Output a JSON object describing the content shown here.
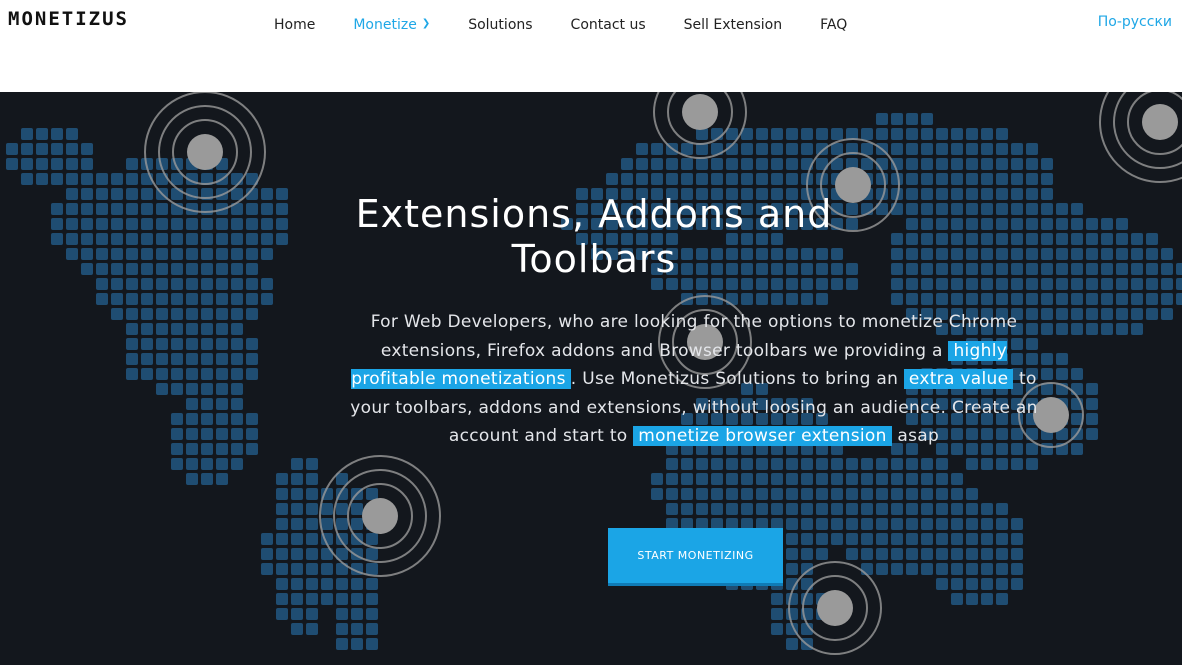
{
  "header": {
    "logo": "MONETIZUS",
    "nav": [
      {
        "label": "Home"
      },
      {
        "label": "Monetize",
        "active": true
      },
      {
        "label": "Solutions"
      },
      {
        "label": "Contact us"
      },
      {
        "label": "Sell Extension"
      },
      {
        "label": "FAQ"
      }
    ],
    "language_link": "По-русски"
  },
  "hero": {
    "title": "Extensions, Addons and Toolbars",
    "paragraph": {
      "part1": "For Web Developers, who are looking for the options to monetize Chrome extensions, Firefox addons and Browser toolbars we providing a",
      "highlight1": "highly profitable monetizations",
      "part2": ". Use Monetizus Solutions to bring an",
      "highlight2": "extra value",
      "part3": "to your toolbars, addons and extensions, without loosing an audience. Create an account and start to",
      "highlight3": "monetize browser extension",
      "part4": "asap"
    },
    "cta_label": "START MONETIZING"
  },
  "colors": {
    "accent": "#1ba5e6",
    "hero_background": "#13171d",
    "map_dots": "#1f4d72",
    "pulse_markers": "#9a9a9a"
  },
  "icons": {
    "dropdown": "chevron-down-icon"
  }
}
